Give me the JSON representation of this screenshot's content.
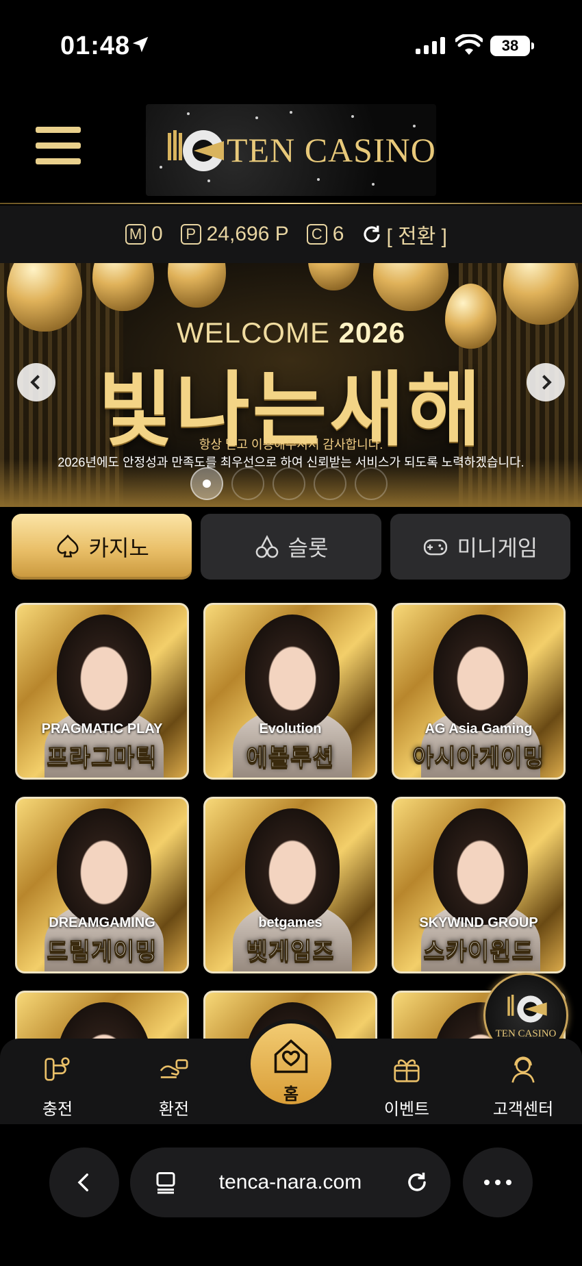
{
  "status_bar": {
    "time": "01:48",
    "battery": "38"
  },
  "header": {
    "logo_text": "TEN CASINO"
  },
  "balance": {
    "m_badge": "M",
    "m_value": "0",
    "p_badge": "P",
    "p_value": "24,696 P",
    "c_badge": "C",
    "c_value": "6",
    "convert_label": "[ 전환 ]"
  },
  "banner": {
    "welcome_prefix": "WELCOME",
    "welcome_year": "2026",
    "headline": "빛나는새해",
    "subtitle1": "항상 믿고 이용해주셔서 감사합니다.",
    "subtitle2": "2026년에도 안정성과 만족도를 최우선으로 하여 신뢰받는 서비스가 되도록 노력하겠습니다.",
    "slide_count": 5,
    "active_slide": 1
  },
  "tabs": [
    {
      "label": "카지노",
      "icon": "spade-icon",
      "active": true
    },
    {
      "label": "슬롯",
      "icon": "cherry-icon",
      "active": false
    },
    {
      "label": "미니게임",
      "icon": "gamepad-icon",
      "active": false
    }
  ],
  "games": [
    {
      "name": "프라그마틱",
      "provider": "PRAGMATIC PLAY"
    },
    {
      "name": "에볼루션",
      "provider": "Evolution"
    },
    {
      "name": "아시아게이밍",
      "provider": "AG Asia Gaming"
    },
    {
      "name": "드림게이밍",
      "provider": "DREAMGAMING"
    },
    {
      "name": "벳게임즈",
      "provider": "betgames"
    },
    {
      "name": "스카이윈드",
      "provider": "SKYWIND GROUP"
    },
    {
      "name": "",
      "provider": ""
    },
    {
      "name": "",
      "provider": ""
    },
    {
      "name": "",
      "provider": ""
    }
  ],
  "floating_logo": {
    "text": "TEN CASINO"
  },
  "bottom_nav": {
    "charge": "충전",
    "withdraw": "환전",
    "home": "홈",
    "event": "이벤트",
    "support": "고객센터"
  },
  "browser": {
    "url": "tenca-nara.com"
  },
  "colors": {
    "gold": "#e9bf68",
    "gold_light": "#fbe4a6",
    "panel": "#2b2b2d",
    "bar": "#151516"
  }
}
